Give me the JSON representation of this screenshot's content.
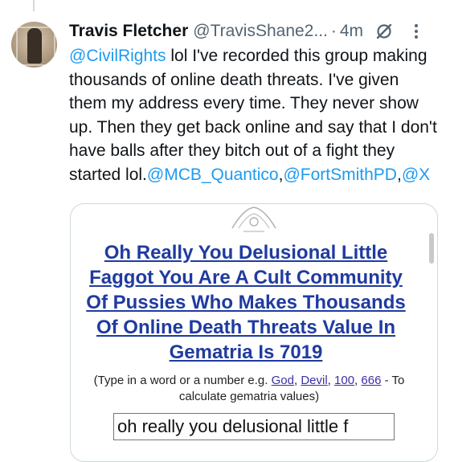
{
  "post": {
    "author_name": "Travis Fletcher",
    "author_handle": "@TravisShane2...",
    "separator": "·",
    "time": "4m",
    "grok_icon": "grok-icon",
    "more_icon": "more-icon",
    "text": {
      "mention_civilrights": "@CivilRights",
      "body": " lol I've recorded this group making thousands of online death threats. I've given them my address every time. They never show up. Then they get back online and say that I don't have balls after they bitch out of a fight they started lol.",
      "mention_quantico": "@MCB_Quantico",
      "comma1": ",",
      "mention_fortsmith": "@FortSmithPD",
      "comma2": ",",
      "mention_x": "@X"
    }
  },
  "card": {
    "title": "Oh Really You Delusional Little Faggot You Are A Cult Community Of Pussies Who Makes Thousands Of Online Death Threats Value In Gematria Is 7019",
    "hint_prefix": "(Type in a word or a number e.g. ",
    "hint_link_god": "God",
    "hint_comma1": ", ",
    "hint_link_devil": "Devil",
    "hint_comma2": ", ",
    "hint_link_100": "100",
    "hint_comma3": ", ",
    "hint_link_666": "666",
    "hint_suffix": " - To calculate gematria values)",
    "input_value": "oh really you delusional little f"
  },
  "colors": {
    "link_blue": "#1d9bf0",
    "title_blue": "#1f3ba0",
    "secondary_text": "#536471"
  }
}
